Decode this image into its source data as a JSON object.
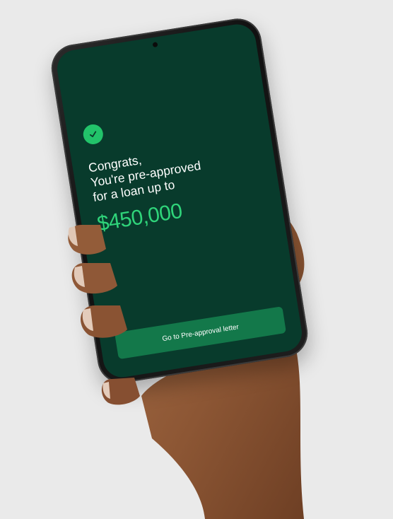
{
  "screen": {
    "badge_icon": "check-icon",
    "headline_lines": [
      "Congrats,",
      "You're pre-approved",
      "for a loan up to"
    ],
    "amount": "$450,000",
    "cta_label": "Go to Pre-approval letter"
  },
  "colors": {
    "background": "#eaeaea",
    "screen": "#083b2c",
    "accent": "#2fd47a",
    "badge": "#22c36a",
    "button": "#13784a",
    "text": "#ffffff"
  }
}
